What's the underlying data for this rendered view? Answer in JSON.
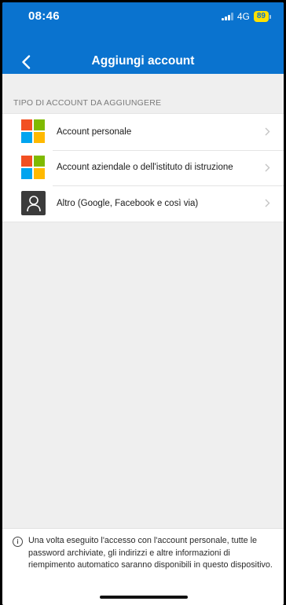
{
  "status_bar": {
    "time": "08:46",
    "network": "4G",
    "battery": "89"
  },
  "nav": {
    "title": "Aggiungi account",
    "back_icon": "chevron-left-icon"
  },
  "section_header": "TIPO DI ACCOUNT DA AGGIUNGERE",
  "account_types": [
    {
      "label": "Account personale",
      "icon": "microsoft-logo-icon"
    },
    {
      "label": "Account aziendale o dell'istituto di istruzione",
      "icon": "microsoft-logo-icon"
    },
    {
      "label": "Altro (Google, Facebook e così via)",
      "icon": "person-icon"
    }
  ],
  "footer": {
    "info_icon": "info-icon",
    "text": "Una volta eseguito l'accesso con l'account personale, tutte le password archiviate, gli indirizzi e altre informazioni di riempimento automatico saranno disponibili in questo dispositivo."
  },
  "colors": {
    "header_blue": "#0a73cf",
    "battery_yellow": "#ffe100",
    "ms_red": "#f25022",
    "ms_green": "#7fba00",
    "ms_blue": "#00a4ef",
    "ms_yellow": "#ffb900"
  }
}
